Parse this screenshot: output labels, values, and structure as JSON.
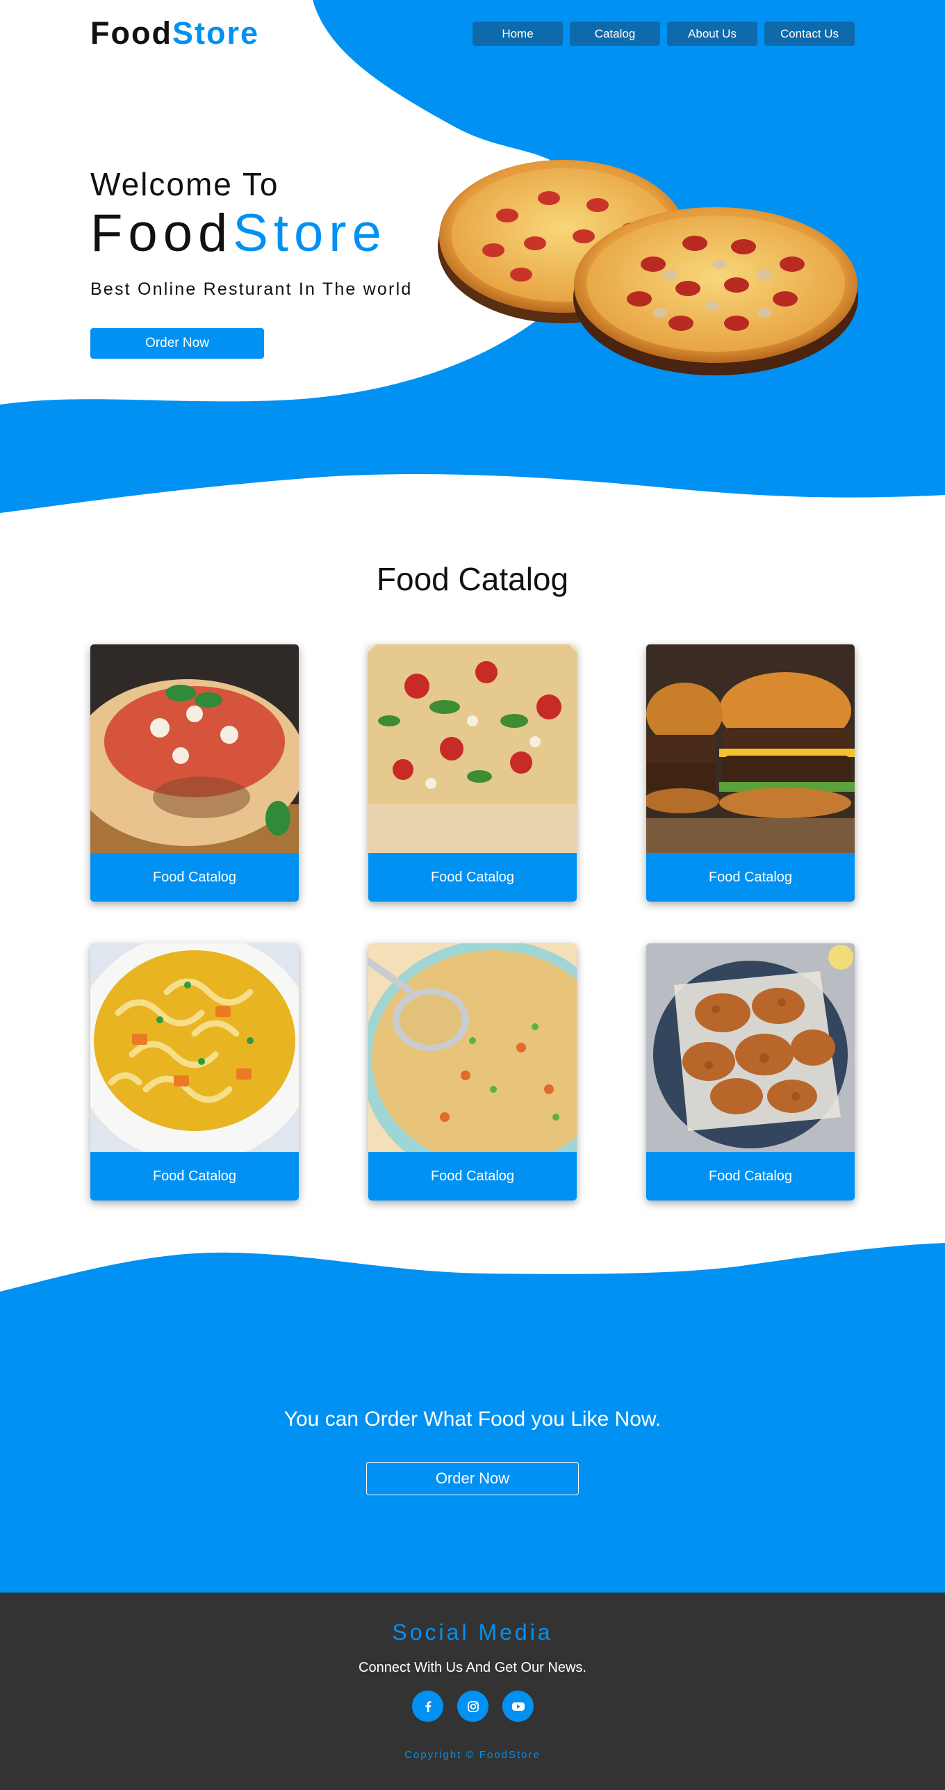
{
  "header": {
    "logo_part1": "Food",
    "logo_part2": "Store",
    "nav": [
      "Home",
      "Catalog",
      "About Us",
      "Contact Us"
    ]
  },
  "hero": {
    "welcome": "Welcome To",
    "brand_part1": "Food",
    "brand_part2": "Store",
    "tagline": "Best Online Resturant In The world",
    "order_button": "Order Now",
    "image_icon": "pizza-image"
  },
  "catalog": {
    "title": "Food Catalog",
    "items": [
      {
        "label": "Food Catalog",
        "image_icon": "pizza-margherita-image"
      },
      {
        "label": "Food Catalog",
        "image_icon": "pizza-tomato-image"
      },
      {
        "label": "Food Catalog",
        "image_icon": "burger-image"
      },
      {
        "label": "Food Catalog",
        "image_icon": "noodle-soup-image"
      },
      {
        "label": "Food Catalog",
        "image_icon": "vegetable-soup-image"
      },
      {
        "label": "Food Catalog",
        "image_icon": "fried-chicken-image"
      }
    ]
  },
  "cta": {
    "text": "You can Order What Food you Like Now.",
    "button": "Order Now"
  },
  "footer": {
    "social_title": "Social Media",
    "subtitle": "Connect With Us And Get Our News.",
    "icons": [
      "facebook-icon",
      "instagram-icon",
      "youtube-icon"
    ],
    "copyright": "Copyright © FoodStore"
  },
  "colors": {
    "accent": "#0091f2",
    "nav_button": "#0f6aac",
    "footer_bg": "#333333",
    "text_dark": "#111111"
  }
}
